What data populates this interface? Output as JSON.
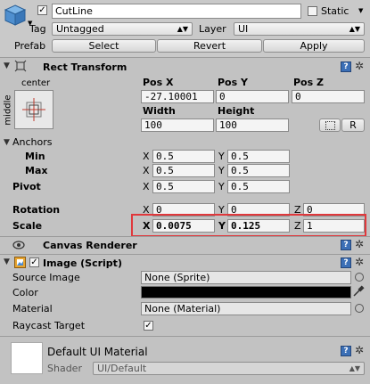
{
  "object": {
    "active": true,
    "name": "CutLine",
    "static_label": "Static",
    "static_checked": false,
    "tag_label": "Tag",
    "tag_value": "Untagged",
    "layer_label": "Layer",
    "layer_value": "UI",
    "prefab_label": "Prefab",
    "prefab_buttons": [
      "Select",
      "Revert",
      "Apply"
    ]
  },
  "rect_transform": {
    "title": "Rect Transform",
    "anchor_preset_top": "center",
    "anchor_preset_side": "middle",
    "col_headers": [
      "Pos X",
      "Pos Y",
      "Pos Z"
    ],
    "pos": [
      "-27.10001",
      "0",
      "0"
    ],
    "size_headers": [
      "Width",
      "Height"
    ],
    "size": [
      "100",
      "100"
    ],
    "r_button": "R",
    "anchors_label": "Anchors",
    "min_label": "Min",
    "max_label": "Max",
    "pivot_label": "Pivot",
    "axis": [
      "X",
      "Y",
      "Z"
    ],
    "anchor_min": [
      "0.5",
      "0.5"
    ],
    "anchor_max": [
      "0.5",
      "0.5"
    ],
    "pivot": [
      "0.5",
      "0.5"
    ],
    "rotation_label": "Rotation",
    "rotation": [
      "0",
      "0",
      "0"
    ],
    "scale_label": "Scale",
    "scale": [
      "0.0075",
      "0.125",
      "1"
    ]
  },
  "canvas_renderer": {
    "title": "Canvas Renderer"
  },
  "image": {
    "title": "Image (Script)",
    "enabled": true,
    "source_image_label": "Source Image",
    "source_image_value": "None (Sprite)",
    "color_label": "Color",
    "color_value": "#000000",
    "material_label": "Material",
    "material_value": "None (Material)",
    "raycast_label": "Raycast Target",
    "raycast_checked": true
  },
  "material": {
    "title": "Default UI Material",
    "shader_label": "Shader",
    "shader_value": "UI/Default"
  },
  "colors": {
    "highlight": "#e0383c",
    "background": "#c2c2c2"
  },
  "icons": [
    "gameobject-cube-icon",
    "rect-transform-icon",
    "help-book-icon",
    "gear-icon",
    "eye-icon",
    "image-component-icon",
    "color-picker-icon"
  ]
}
